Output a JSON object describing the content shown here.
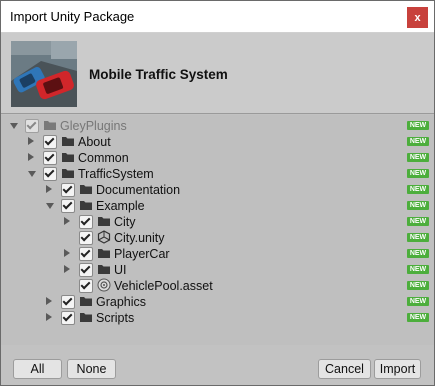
{
  "window": {
    "title": "Import Unity Package",
    "close_label": "x"
  },
  "header": {
    "package_name": "Mobile Traffic System"
  },
  "tree": {
    "badge": "NEW",
    "items": [
      {
        "label": "GleyPlugins",
        "type": "folder",
        "fold": "expanded",
        "grayed": true
      },
      {
        "label": "About",
        "type": "folder",
        "fold": "collapsed",
        "grayed": false
      },
      {
        "label": "Common",
        "type": "folder",
        "fold": "collapsed",
        "grayed": false
      },
      {
        "label": "TrafficSystem",
        "type": "folder",
        "fold": "expanded",
        "grayed": false
      },
      {
        "label": "Documentation",
        "type": "folder",
        "fold": "collapsed",
        "grayed": false
      },
      {
        "label": "Example",
        "type": "folder",
        "fold": "expanded",
        "grayed": false
      },
      {
        "label": "City",
        "type": "folder",
        "fold": "collapsed",
        "grayed": false
      },
      {
        "label": "City.unity",
        "type": "scene",
        "fold": "none",
        "grayed": false
      },
      {
        "label": "PlayerCar",
        "type": "folder",
        "fold": "collapsed",
        "grayed": false
      },
      {
        "label": "UI",
        "type": "folder",
        "fold": "collapsed",
        "grayed": false
      },
      {
        "label": "VehiclePool.asset",
        "type": "asset",
        "fold": "none",
        "grayed": false
      },
      {
        "label": "Graphics",
        "type": "folder",
        "fold": "collapsed",
        "grayed": false
      },
      {
        "label": "Scripts",
        "type": "folder",
        "fold": "collapsed",
        "grayed": false
      }
    ]
  },
  "footer": {
    "all_label": "All",
    "none_label": "None",
    "cancel_label": "Cancel",
    "import_label": "Import"
  }
}
